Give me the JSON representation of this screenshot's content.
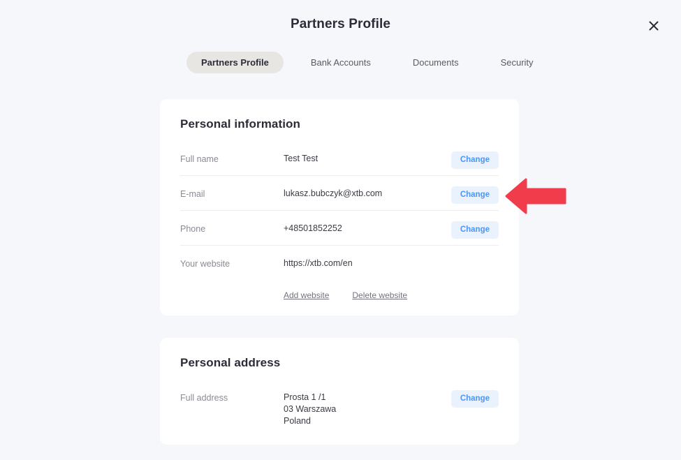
{
  "modal": {
    "title": "Partners Profile",
    "close_icon": "close-icon"
  },
  "tabs": [
    {
      "label": "Partners Profile",
      "active": true
    },
    {
      "label": "Bank Accounts",
      "active": false
    },
    {
      "label": "Documents",
      "active": false
    },
    {
      "label": "Security",
      "active": false
    }
  ],
  "cards": {
    "personal_information": {
      "title": "Personal information",
      "rows": [
        {
          "label": "Full name",
          "value": "Test Test",
          "action": "Change"
        },
        {
          "label": "E-mail",
          "value": "lukasz.bubczyk@xtb.com",
          "action": "Change"
        },
        {
          "label": "Phone",
          "value": "+48501852252",
          "action": "Change"
        },
        {
          "label": "Your website",
          "value": "https://xtb.com/en",
          "action": ""
        }
      ],
      "website_links": [
        {
          "label": "Add website"
        },
        {
          "label": "Delete website"
        }
      ]
    },
    "personal_address": {
      "title": "Personal address",
      "rows": [
        {
          "label": "Full address",
          "value": "Prosta 1 /1\n03 Warszawa\nPoland",
          "action": "Change"
        }
      ]
    }
  },
  "annotation": {
    "type": "arrow-left",
    "color": "#f03c4b",
    "points_at": "E-mail Change button"
  },
  "colors": {
    "page_background": "#f6f7fb",
    "card_background": "#ffffff",
    "accent_blue": "#4c95f3",
    "accent_blue_bg": "#e9f2fd",
    "active_tab_bg": "#e7e6e3",
    "text_primary": "#2c2c38",
    "text_muted": "#8a8a96",
    "divider": "#edeef2",
    "annotation_red": "#f03c4b"
  }
}
